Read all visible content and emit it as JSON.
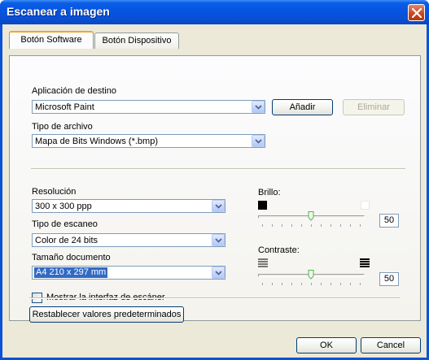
{
  "window": {
    "title": "Escanear a imagen"
  },
  "tabs": [
    {
      "label": "Botón Software",
      "active": true
    },
    {
      "label": "Botón Dispositivo",
      "active": false
    }
  ],
  "destination": {
    "label": "Aplicación de destino",
    "value": "Microsoft Paint",
    "add_label": "Añadir",
    "delete_label": "Eliminar"
  },
  "file_type": {
    "label": "Tipo de archivo",
    "value": "Mapa de Bits Windows (*.bmp)"
  },
  "resolution": {
    "label": "Resolución",
    "value": "300 x 300 ppp"
  },
  "scan_type": {
    "label": "Tipo de escaneo",
    "value": "Color de 24 bits"
  },
  "doc_size": {
    "label": "Tamaño documento",
    "value": "A4 210 x 297 mm"
  },
  "show_interface": {
    "label": "Mostrar la interfaz de escáner",
    "checked": false
  },
  "brightness": {
    "label": "Brillo:",
    "value": "50"
  },
  "contrast": {
    "label": "Contraste:",
    "value": "50"
  },
  "reset_label": "Restablecer valores predeterminados",
  "ok_label": "OK",
  "cancel_label": "Cancel",
  "colors": {
    "title_bar": "#0554e0",
    "dialog_bg": "#ece9d8",
    "selection": "#316ac5",
    "tab_highlight": "#f1a62b"
  }
}
